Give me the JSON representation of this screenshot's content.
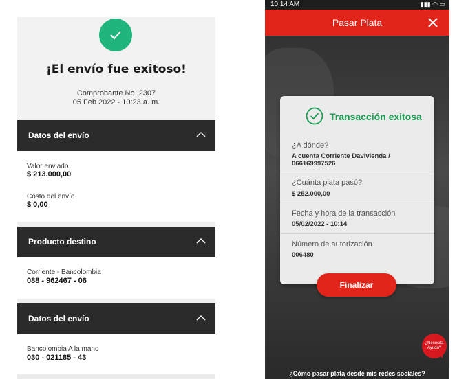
{
  "left": {
    "title": "¡El envío fue exitoso!",
    "receipt_no": "Comprobante No. 2307",
    "receipt_date": "05 Feb 2022 - 10:23 a. m.",
    "section1": {
      "title": "Datos del envío",
      "sent_label": "Valor enviado",
      "sent_value": "$ 213.000,00",
      "cost_label": "Costo del envío",
      "cost_value": "$ 0,00"
    },
    "section2": {
      "title": "Producto destino",
      "account_label": "Corriente - Bancolombia",
      "account_value": "088 - 962467 - 06"
    },
    "section3": {
      "title": "Datos del envío",
      "account_label": "Bancolombia A la mano",
      "account_value": "030 - 021185 - 43"
    },
    "success_color": "#1fb57d"
  },
  "phone": {
    "status_time": "10:14 AM",
    "header_title": "Pasar Plata",
    "card_title": "Transacción exitosa",
    "rows": [
      {
        "label": "¿A dónde?",
        "value": "A cuenta Corriente Davivienda / 066169997526"
      },
      {
        "label": "¿Cuánta plata pasó?",
        "value": "$ 252.000,00"
      },
      {
        "label": "Fecha y hora de la transacción",
        "value": "05/02/2022 - 10:14"
      },
      {
        "label": "Número de autorización",
        "value": "006480"
      }
    ],
    "finish_label": "Finalizar",
    "help_text": "¿Necesita Ayuda?",
    "bottom_link": "¿Cómo pasar plata desde mis redes sociales?",
    "accent_color": "#e1251b",
    "success_color": "#1a9e53"
  }
}
